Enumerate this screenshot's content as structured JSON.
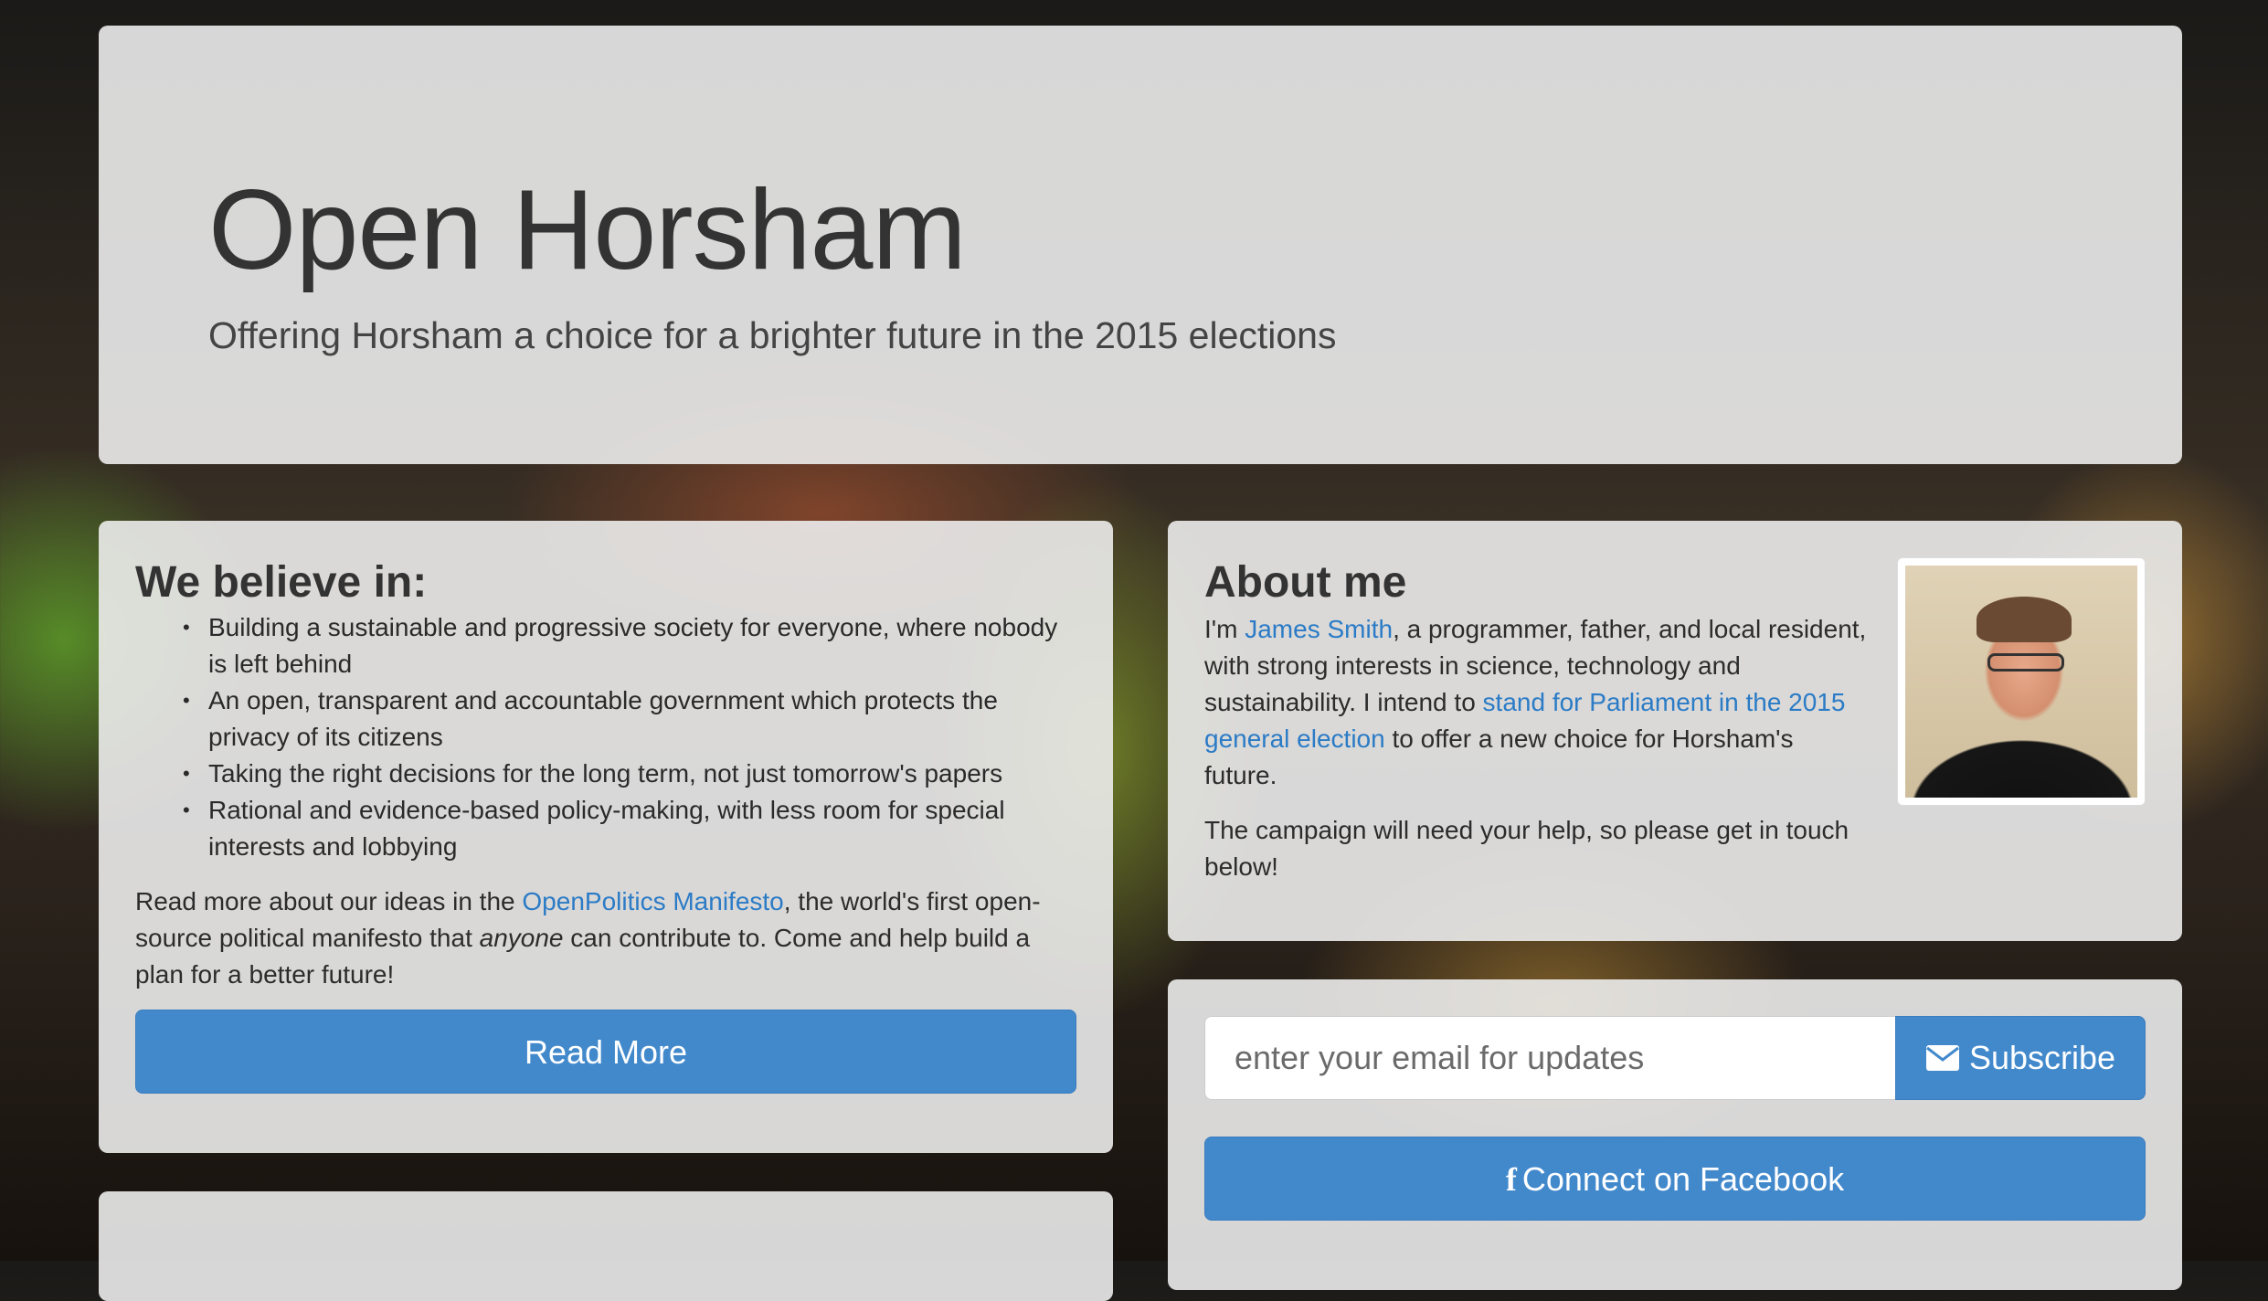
{
  "header": {
    "title": "Open Horsham",
    "subtitle": "Offering Horsham a choice for a brighter future in the 2015 elections"
  },
  "believe": {
    "heading": "We believe in:",
    "items": [
      "Building a sustainable and progressive society for everyone, where nobody is left behind",
      "An open, transparent and accountable government which protects the privacy of its citizens",
      "Taking the right decisions for the long term, not just tomorrow's papers",
      "Rational and evidence-based policy-making, with less room for special interests and lobbying"
    ],
    "readmore_prefix": "Read more about our ideas in the ",
    "manifesto_link": "OpenPolitics Manifesto",
    "readmore_middle": ", the world's first open-source political manifesto that ",
    "readmore_emphasis": "anyone",
    "readmore_suffix": " can contribute to. Come and help build a plan for a better future!",
    "button_label": "Read More"
  },
  "about": {
    "heading": "About me",
    "intro_prefix": "I'm ",
    "name_link": "James Smith",
    "intro_middle": ", a programmer, father, and local resident, with strong interests in science, technology and sustainability. I intend to ",
    "parliament_link": "stand for Parliament in the 2015 general election",
    "intro_suffix": " to offer a new choice for Horsham's future.",
    "help_text": "The campaign will need your help, so please get in touch below!",
    "photo_alt": "James Smith"
  },
  "subscribe": {
    "email_placeholder": "enter your email for updates",
    "button_label": "Subscribe",
    "button_icon": "envelope-icon",
    "facebook_label": "Connect on Facebook",
    "facebook_icon": "facebook-icon"
  },
  "colors": {
    "accent": "#4289cc",
    "link": "#2b7bc6",
    "panel": "#ececec"
  }
}
